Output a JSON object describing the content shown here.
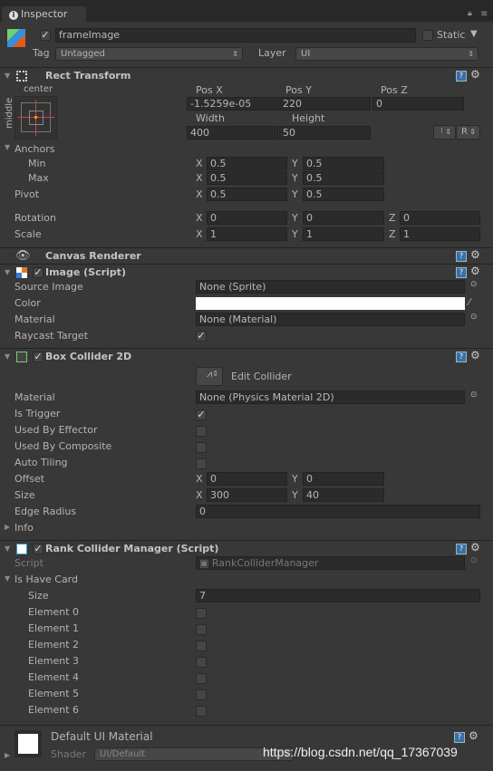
{
  "tab": {
    "title": "Inspector"
  },
  "object": {
    "name": "frameImage",
    "active": true,
    "static_label": "Static",
    "static": false,
    "tag_label": "Tag",
    "tag": "Untagged",
    "layer_label": "Layer",
    "layer": "UI"
  },
  "rect": {
    "title": "Rect Transform",
    "anchor_h": "center",
    "anchor_v": "middle",
    "pos_labels": [
      "Pos X",
      "Pos Y",
      "Pos Z"
    ],
    "pos": [
      "-1.5259e-05",
      "220",
      "0"
    ],
    "size_labels": [
      "Width",
      "Height"
    ],
    "size": [
      "400",
      "50"
    ],
    "blueprint_label": "⁝⁝",
    "raw_label": "R",
    "anchors_label": "Anchors",
    "min_label": "Min",
    "min": [
      "0.5",
      "0.5"
    ],
    "max_label": "Max",
    "max": [
      "0.5",
      "0.5"
    ],
    "pivot_label": "Pivot",
    "pivot": [
      "0.5",
      "0.5"
    ],
    "rotation_label": "Rotation",
    "rotation": [
      "0",
      "0",
      "0"
    ],
    "scale_label": "Scale",
    "scale": [
      "1",
      "1",
      "1"
    ],
    "axis": [
      "X",
      "Y",
      "Z"
    ]
  },
  "canvas_renderer": {
    "title": "Canvas Renderer"
  },
  "image": {
    "title": "Image (Script)",
    "enabled": true,
    "source_label": "Source Image",
    "source": "None (Sprite)",
    "color_label": "Color",
    "color": "#ffffff",
    "material_label": "Material",
    "material": "None (Material)",
    "raycast_label": "Raycast Target",
    "raycast": true
  },
  "box": {
    "title": "Box Collider 2D",
    "enabled": true,
    "edit_label": "Edit Collider",
    "material_label": "Material",
    "material": "None (Physics Material 2D)",
    "bools": [
      {
        "label": "Is Trigger",
        "value": true
      },
      {
        "label": "Used By Effector",
        "value": false
      },
      {
        "label": "Used By Composite",
        "value": false
      },
      {
        "label": "Auto Tiling",
        "value": false
      }
    ],
    "offset_label": "Offset",
    "offset": [
      "0",
      "0"
    ],
    "size_label": "Size",
    "size": [
      "300",
      "40"
    ],
    "edge_label": "Edge Radius",
    "edge": "0",
    "info_label": "Info"
  },
  "rank": {
    "title": "Rank Collider Manager (Script)",
    "enabled": true,
    "script_label": "Script",
    "script": "RankColliderManager",
    "array_label": "Is Have Card",
    "size_label": "Size",
    "size": "7",
    "elements": [
      {
        "label": "Element 0",
        "value": false
      },
      {
        "label": "Element 1",
        "value": false
      },
      {
        "label": "Element 2",
        "value": false
      },
      {
        "label": "Element 3",
        "value": false
      },
      {
        "label": "Element 4",
        "value": false
      },
      {
        "label": "Element 5",
        "value": false
      },
      {
        "label": "Element 6",
        "value": false
      }
    ]
  },
  "material_footer": {
    "title": "Default UI Material",
    "shader_label": "Shader",
    "shader": "UI/Default"
  },
  "watermark": "https://blog.csdn.net/qq_17367039"
}
